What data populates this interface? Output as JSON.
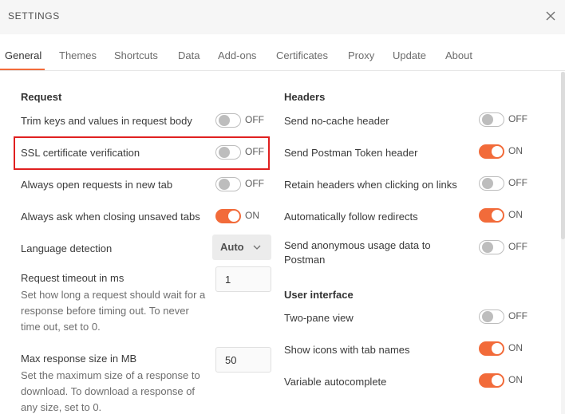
{
  "window": {
    "title": "SETTINGS",
    "close_icon": "close-icon"
  },
  "tabs": [
    {
      "label": "General",
      "active": true
    },
    {
      "label": "Themes"
    },
    {
      "label": "Shortcuts"
    },
    {
      "label": "Data"
    },
    {
      "label": "Add-ons"
    },
    {
      "label": "Certificates"
    },
    {
      "label": "Proxy"
    },
    {
      "label": "Update"
    },
    {
      "label": "About"
    }
  ],
  "request": {
    "title": "Request",
    "trim_keys": {
      "label": "Trim keys and values in request body",
      "state": "OFF"
    },
    "ssl_verification": {
      "label": "SSL certificate verification",
      "state": "OFF"
    },
    "open_new_tab": {
      "label": "Always open requests in new tab",
      "state": "OFF"
    },
    "ask_closing": {
      "label": "Always ask when closing unsaved tabs",
      "state": "ON"
    },
    "language_detection": {
      "label": "Language detection",
      "value": "Auto"
    },
    "timeout": {
      "label": "Request timeout in ms",
      "description": "Set how long a request should wait for a response before timing out. To never time out, set to 0.",
      "value": "1"
    },
    "max_response": {
      "label": "Max response size in MB",
      "description": "Set the maximum size of a response to download. To download a response of any size, set to 0.",
      "value": "50"
    }
  },
  "headers": {
    "title": "Headers",
    "no_cache": {
      "label": "Send no-cache header",
      "state": "OFF"
    },
    "postman_token": {
      "label": "Send Postman Token header",
      "state": "ON"
    },
    "retain_headers": {
      "label": "Retain headers when clicking on links",
      "state": "OFF"
    },
    "follow_redirects": {
      "label": "Automatically follow redirects",
      "state": "ON"
    },
    "anonymous_usage": {
      "label": "Send anonymous usage data to Postman",
      "state": "OFF"
    }
  },
  "user_interface": {
    "title": "User interface",
    "two_pane": {
      "label": "Two-pane view",
      "state": "OFF"
    },
    "icons_tab_names": {
      "label": "Show icons with tab names",
      "state": "ON"
    },
    "variable_autocomplete": {
      "label": "Variable autocomplete",
      "state": "ON"
    }
  },
  "colors": {
    "accent": "#f26b3a",
    "highlight_box": "#e02020"
  }
}
